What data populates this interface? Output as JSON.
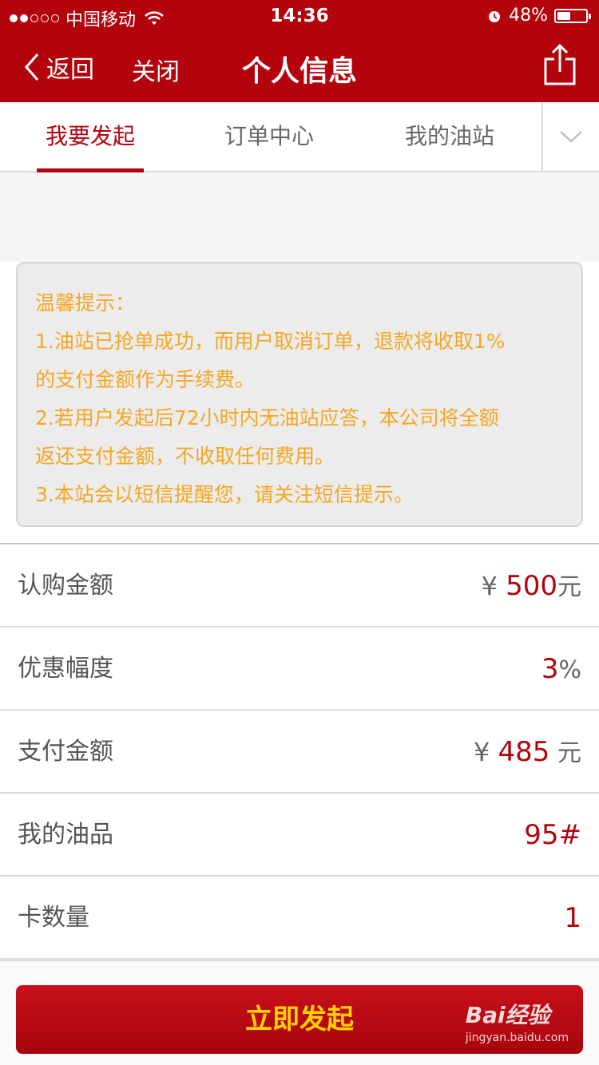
{
  "status_bar": {
    "carrier": "中国移动",
    "time": "14:36",
    "battery": "48%",
    "battery_level": 0.48,
    "signal_filled": 2,
    "signal_total": 5
  },
  "nav": {
    "back_label": "返回",
    "close_label": "关闭",
    "title": "个人信息"
  },
  "tabs": [
    {
      "label": "我要发起",
      "active": true
    },
    {
      "label": "订单中心",
      "active": false
    },
    {
      "label": "我的油站",
      "active": false
    }
  ],
  "notice": {
    "lines": [
      "温馨提示：",
      "1.油站已抢单成功，而用户取消订单，退款将收取1%",
      "的支付金额作为手续费。",
      "2.若用户发起后72小时内无油站应答，本公司将全额",
      "返还支付金额，不收取任何费用。",
      "3.本站会以短信提醒您，请关注短信提示。"
    ]
  },
  "rows": [
    {
      "label": "认购金额",
      "prefix": "¥ ",
      "value": "500",
      "unit": "元"
    },
    {
      "label": "优惠幅度",
      "prefix": "",
      "value": "3",
      "unit": "%"
    },
    {
      "label": "支付金额",
      "prefix": "¥ ",
      "value": "485",
      "unit": " 元"
    },
    {
      "label": "我的油品",
      "prefix": "",
      "value": "95#",
      "unit": ""
    },
    {
      "label": "卡数量",
      "prefix": "",
      "value": "1",
      "unit": ""
    }
  ],
  "submit_label": "立即发起",
  "watermark": {
    "main": "Bai经验",
    "sub": "jingyan.baidu.com"
  },
  "colors": {
    "brand_red": "#b3040d",
    "notice_text": "#f5a623",
    "button_text": "#ffd200"
  }
}
